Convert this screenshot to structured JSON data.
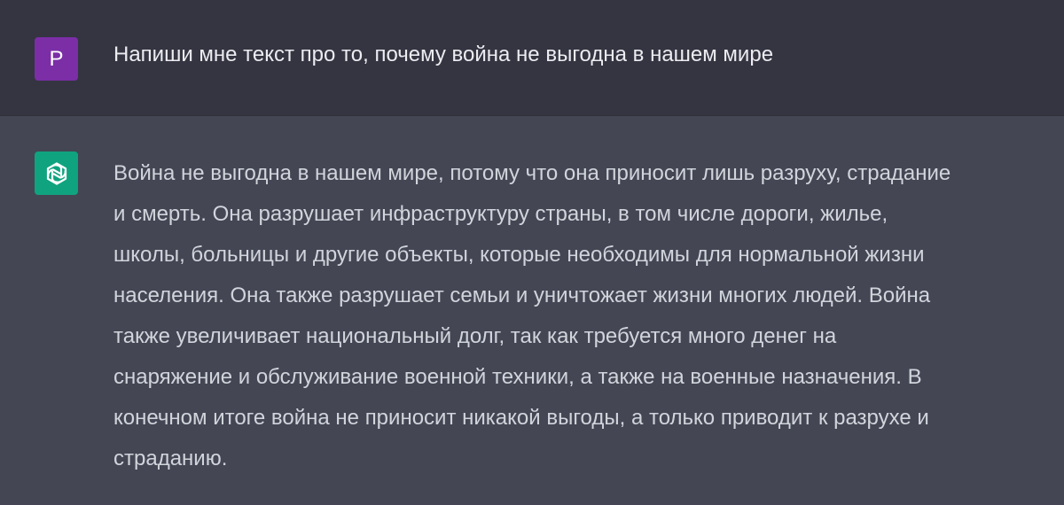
{
  "colors": {
    "user_row_bg": "#343541",
    "assistant_row_bg": "#444654",
    "user_avatar_bg": "#7b2ea6",
    "assistant_avatar_bg": "#10a37f",
    "user_text": "#ececf1",
    "assistant_text": "#d1d5db"
  },
  "user_message": {
    "avatar_letter": "P",
    "text": "Напиши мне текст про то, почему война не выгодна в нашем мире"
  },
  "assistant_message": {
    "avatar_icon": "openai-logo-icon",
    "lines": [
      "Война не выгодна в нашем мире, потому что она приносит лишь разруху, страдание",
      "и смерть. Она разрушает инфраструктуру страны, в том числе дороги, жилье,",
      "школы, больницы и другие объекты, которые необходимы для нормальной жизни",
      "населения. Она также разрушает семьи и уничтожает жизни многих людей. Война",
      "также увеличивает национальный долг, так как требуется много денег на",
      "снаряжение и обслуживание военной техники, а также на военные назначения. В",
      "конечном итоге война не приносит никакой выгоды, а только приводит к разрухе и",
      "страданию."
    ]
  }
}
